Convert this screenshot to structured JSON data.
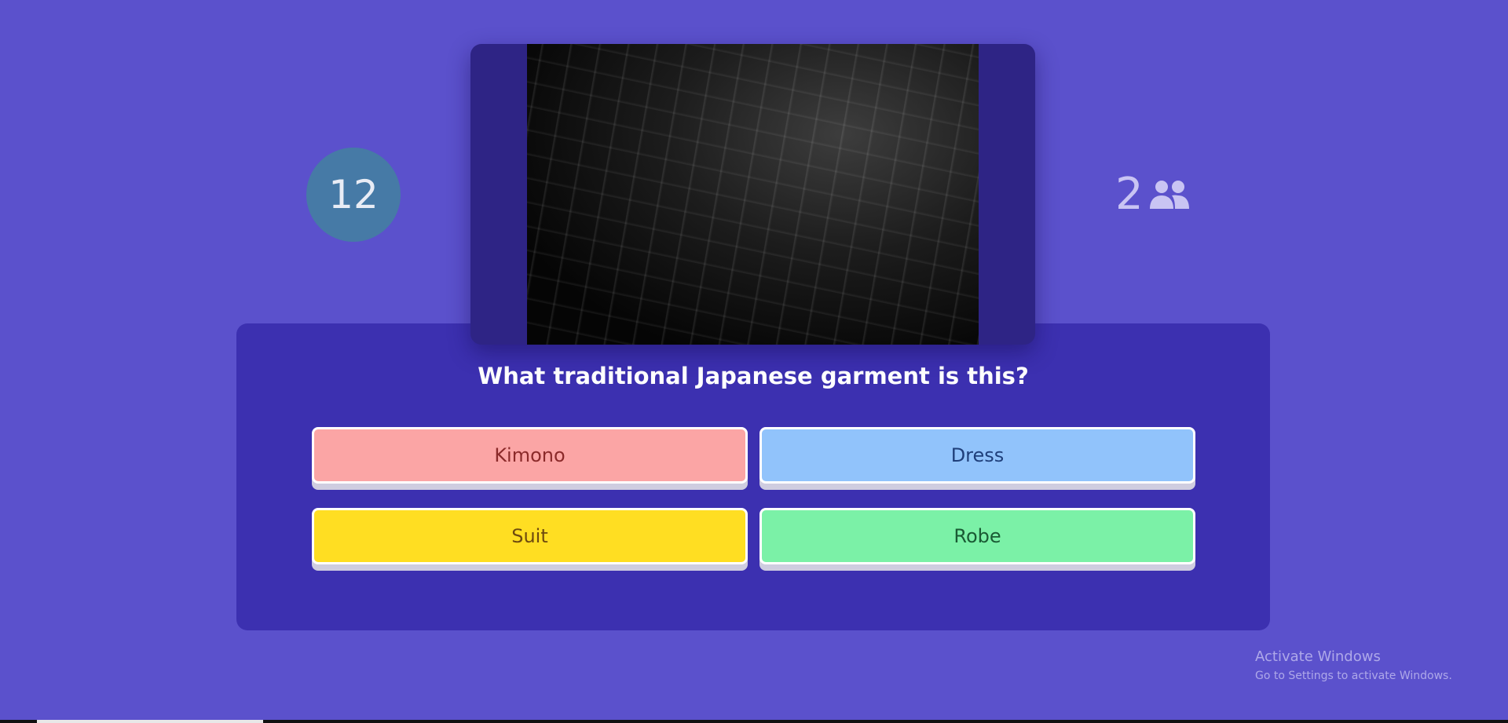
{
  "timer": {
    "value": "12"
  },
  "players": {
    "count": "2",
    "icon": "people-icon"
  },
  "question": {
    "text": "What traditional Japanese garment is this?",
    "image_alt": "dark building facade photo"
  },
  "answers": [
    {
      "label": "Kimono",
      "color": "#fba5a5"
    },
    {
      "label": "Dress",
      "color": "#91c3fb"
    },
    {
      "label": "Suit",
      "color": "#ffde22"
    },
    {
      "label": "Robe",
      "color": "#7bf1a7"
    }
  ],
  "watermark": {
    "title": "Activate Windows",
    "subtitle": "Go to Settings to activate Windows."
  },
  "colors": {
    "background": "#5b51cc",
    "panel": "#3c30b0",
    "media_card": "#2e2485",
    "timer": "#467aa6"
  }
}
